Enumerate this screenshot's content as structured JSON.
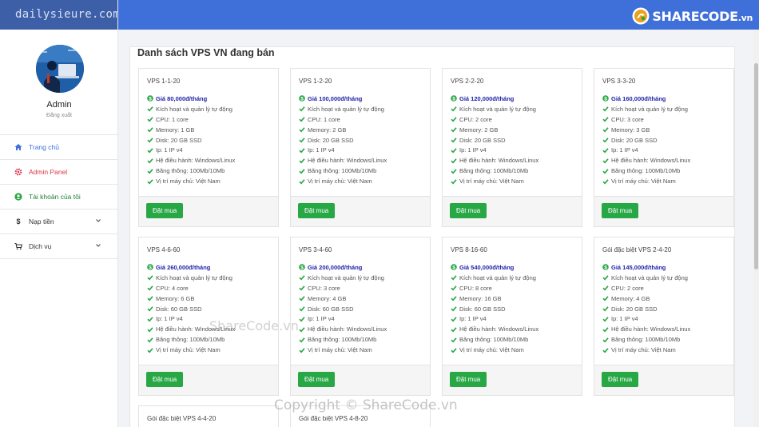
{
  "sidebar": {
    "brand": "dailysieure.com",
    "profile": {
      "name": "Admin",
      "logout": "Đăng xuất"
    },
    "menu": [
      {
        "label": "Trang chủ",
        "icon": "home-icon",
        "color": "#3f6fd8"
      },
      {
        "label": "Admin Panel",
        "icon": "gear-icon",
        "color": "#dc3545"
      },
      {
        "label": "Tài khoản của tôi",
        "icon": "user-icon",
        "color": "#28a745"
      },
      {
        "label": "Nạp tiền",
        "icon": "dollar-icon",
        "color": "#333333",
        "has_submenu": true
      },
      {
        "label": "Dịch vụ",
        "icon": "cart-icon",
        "color": "#333333",
        "has_submenu": true
      }
    ]
  },
  "header": {
    "logo_main": "SHARECODE",
    "logo_suffix": ".vn"
  },
  "main": {
    "title": "Danh sách VPS VN đang bán",
    "buy_label": "Đặt mua",
    "cards": [
      {
        "name": "VPS 1-1-20",
        "price": "Giá 80,000đ/tháng",
        "features": [
          "Kích hoạt và quản lý tự động",
          "CPU: 1 core",
          "Memory: 1 GB",
          "Disk: 20 GB SSD",
          "Ip: 1 IP v4",
          "Hệ điều hành: Windows/Linux",
          "Băng thông: 100Mb/10Mb",
          "Vị trí máy chủ: Việt Nam"
        ]
      },
      {
        "name": "VPS 1-2-20",
        "price": "Giá 100,000đ/tháng",
        "features": [
          "Kích hoạt và quản lý tự động",
          "CPU: 1 core",
          "Memory: 2 GB",
          "Disk: 20 GB SSD",
          "Ip: 1 IP v4",
          "Hệ điều hành: Windows/Linux",
          "Băng thông: 100Mb/10Mb",
          "Vị trí máy chủ: Việt Nam"
        ]
      },
      {
        "name": "VPS 2-2-20",
        "price": "Giá 120,000đ/tháng",
        "features": [
          "Kích hoạt và quản lý tự động",
          "CPU: 2 core",
          "Memory: 2 GB",
          "Disk: 20 GB SSD",
          "Ip: 1 IP v4",
          "Hệ điều hành: Windows/Linux",
          "Băng thông: 100Mb/10Mb",
          "Vị trí máy chủ: Việt Nam"
        ]
      },
      {
        "name": "VPS 3-3-20",
        "price": "Giá 160,000đ/tháng",
        "features": [
          "Kích hoạt và quản lý tự động",
          "CPU: 3 core",
          "Memory: 3 GB",
          "Disk: 20 GB SSD",
          "Ip: 1 IP v4",
          "Hệ điều hành: Windows/Linux",
          "Băng thông: 100Mb/10Mb",
          "Vị trí máy chủ: Việt Nam"
        ]
      },
      {
        "name": "VPS 4-6-60",
        "price": "Giá 260,000đ/tháng",
        "features": [
          "Kích hoạt và quản lý tự động",
          "CPU: 4 core",
          "Memory: 6 GB",
          "Disk: 60 GB SSD",
          "Ip: 1 IP v4",
          "Hệ điều hành: Windows/Linux",
          "Băng thông: 100Mb/10Mb",
          "Vị trí máy chủ: Việt Nam"
        ]
      },
      {
        "name": "VPS 3-4-60",
        "price": "Giá 200,000đ/tháng",
        "features": [
          "Kích hoạt và quản lý tự động",
          "CPU: 3 core",
          "Memory: 4 GB",
          "Disk: 60 GB SSD",
          "Ip: 1 IP v4",
          "Hệ điều hành: Windows/Linux",
          "Băng thông: 100Mb/10Mb",
          "Vị trí máy chủ: Việt Nam"
        ]
      },
      {
        "name": "VPS 8-16-60",
        "price": "Giá 540,000đ/tháng",
        "features": [
          "Kích hoạt và quản lý tự động",
          "CPU: 8 core",
          "Memory: 16 GB",
          "Disk: 60 GB SSD",
          "Ip: 1 IP v4",
          "Hệ điều hành: Windows/Linux",
          "Băng thông: 100Mb/10Mb",
          "Vị trí máy chủ: Việt Nam"
        ]
      },
      {
        "name": "Gói đặc biệt VPS 2-4-20",
        "price": "Giá 145,000đ/tháng",
        "features": [
          "Kích hoạt và quản lý tự động",
          "CPU: 2 core",
          "Memory: 4 GB",
          "Disk: 20 GB SSD",
          "Ip: 1 IP v4",
          "Hệ điều hành: Windows/Linux",
          "Băng thông: 100Mb/10Mb",
          "Vị trí máy chủ: Việt Nam"
        ]
      }
    ],
    "partial_cards": [
      {
        "name": "Gói đặc biệt VPS 4-4-20"
      },
      {
        "name": "Gói đặc biệt VPS 4-8-20"
      }
    ]
  },
  "watermarks": {
    "center": "ShareCode.vn",
    "bottom": "Copyright © ShareCode.vn"
  }
}
